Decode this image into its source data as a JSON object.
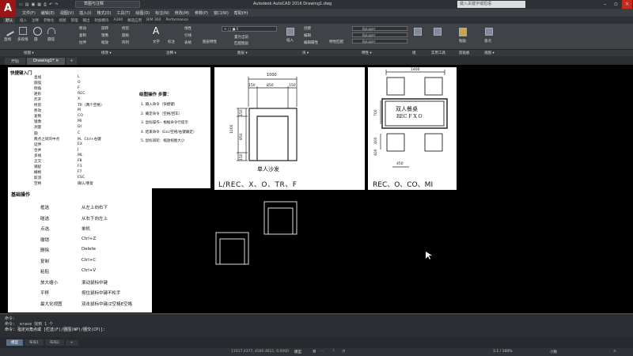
{
  "window": {
    "app_title": "Autodesk AutoCAD 2016    Drawing1.dwg",
    "workspace": "草图与注释",
    "search_placeholder": "键入关键字或短语",
    "logo": "A"
  },
  "menubar": [
    "文件(F)",
    "编辑(E)",
    "视图(V)",
    "插入(I)",
    "格式(O)",
    "工具(T)",
    "绘图(D)",
    "标注(N)",
    "修改(M)",
    "参数(P)",
    "窗口(W)",
    "帮助(H)"
  ],
  "ribbon_tabs": [
    "默认",
    "插入",
    "注释",
    "参数化",
    "视图",
    "管理",
    "输出",
    "附加模块",
    "A360",
    "精选应用",
    "BIM 360",
    "Performance"
  ],
  "ribbon": {
    "draw_tools": [
      "直线",
      "多段线",
      "圆",
      "圆弧"
    ],
    "modify_tools": [
      "移动",
      "旋转",
      "修剪",
      "复制",
      "镜像",
      "圆角",
      "拉伸",
      "缩放",
      "阵列"
    ],
    "annotation_tools": [
      "文字",
      "标注",
      "线性",
      "引线",
      "表格"
    ],
    "layer_tools": [
      "图层特性",
      "置为当前",
      "匹配图层"
    ],
    "block_tools": [
      "插入",
      "创建",
      "编辑",
      "编辑属性"
    ],
    "property_tools": [
      "特性匹配",
      "ByLayer",
      "ByLayer",
      "ByLayer"
    ],
    "group_label": "组",
    "utilities_label": "实用工具",
    "clipboard": [
      "粘贴",
      "剪贴板"
    ],
    "base": "基点",
    "panels": [
      "绘图 ▾",
      "修改 ▾",
      "注释 ▾",
      "图层 ▾",
      "块 ▾",
      "特性 ▾",
      "组",
      "实用工具",
      "剪贴板",
      "视图 ▾"
    ]
  },
  "file_tabs": [
    "开始",
    "Drawing1*"
  ],
  "shortcuts_panel": {
    "title": "快捷键入门",
    "rows": [
      [
        "直线",
        "L"
      ],
      [
        "圆弧",
        "O"
      ],
      [
        "倒角",
        "F"
      ],
      [
        "矩形",
        "REC"
      ],
      [
        "炸开",
        "X"
      ],
      [
        "修剪",
        "TR（两个空格）"
      ],
      [
        "移动",
        "M"
      ],
      [
        "复制",
        "CO"
      ],
      [
        "镜像",
        "MI"
      ],
      [
        "测量",
        "DI"
      ],
      [
        "圆",
        "C"
      ],
      [
        "两点之间的中点",
        "M、Ctrl+右键"
      ],
      [
        "延伸",
        "EX"
      ],
      [
        "合并",
        "J"
      ],
      [
        "多线",
        "ML"
      ],
      [
        "正交",
        "F8"
      ],
      [
        "捕捉",
        "F3"
      ],
      [
        "栅格",
        "F7"
      ],
      [
        "取消",
        "ESC"
      ],
      [
        "空格",
        "确认/重复"
      ]
    ],
    "steps_title": "绘图操作 步骤：",
    "steps": [
      "1. 输入命令（快捷键）",
      "2. 确定命令（空格/回车）",
      "3. 鼠标操作-- 根据命令行提示",
      "4. 结束命令（Esc/空格/右键确定）",
      "5. 鼠标滚轮：缩放视图大小"
    ]
  },
  "basic_ops_panel": {
    "title": "基础操作",
    "rows": [
      [
        "框选",
        "从左上向右下"
      ],
      [
        "碰选",
        "从右下向左上"
      ],
      [
        "点选",
        "单机"
      ],
      [
        "撤销",
        "Ctrl+Z"
      ],
      [
        "删除",
        "Delete"
      ],
      [
        "复制",
        "Ctrl+C"
      ],
      [
        "粘贴",
        "Ctrl+V"
      ],
      [
        "放大缩小",
        "滚动鼠标中键"
      ],
      [
        "平移",
        "按住鼠标中键不松手"
      ],
      [
        "最大化视图",
        "双击鼠标中键/Z空格E空格"
      ]
    ]
  },
  "sofa_panel": {
    "dims": [
      "1000",
      "150",
      "850",
      "150",
      "1000",
      "150",
      "850",
      "150"
    ],
    "title": "单人沙发",
    "caption": "L/REC、X、O、TR、F"
  },
  "table_panel": {
    "dims": [
      "1400",
      "700",
      "400",
      "400",
      "450"
    ],
    "label_line1": "双人餐桌",
    "label_line2": "REC F X O",
    "caption": "REC、O、CO、MI"
  },
  "command": {
    "line1": "命令:",
    "line2": "命令: _erase 找到 1 个",
    "line3": "命令: 指定对角点或 [栏选(F)/圈围(WP)/圈交(CP)]:"
  },
  "layout_tabs": [
    "模型",
    "布局1",
    "布局2"
  ],
  "status": {
    "coords": "11017.4377, 4580.4611, 0.0000",
    "mode": "模型",
    "scale": "1:1 / 100%",
    "units": "小数"
  },
  "colors": {
    "accent": "#9b1515",
    "panel_bg": "#ffffff",
    "drawing_bg": "#000000",
    "ribbon": "#3f4246"
  }
}
